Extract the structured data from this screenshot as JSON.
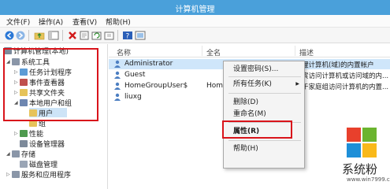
{
  "window": {
    "title": "计算机管理"
  },
  "menu": [
    "文件(F)",
    "操作(A)",
    "查看(V)",
    "帮助(H)"
  ],
  "toolbar": {
    "icons": [
      "back-arrow-icon",
      "forward-arrow-icon",
      "up-folder-icon",
      "console-tree-icon",
      "delete-icon",
      "properties-icon",
      "refresh-icon",
      "export-icon",
      "help-icon",
      "view-icon"
    ]
  },
  "tree": {
    "nodes": [
      {
        "label": "计算机管理(本地)",
        "depth": 0
      },
      {
        "label": "系统工具",
        "depth": 1
      },
      {
        "label": "任务计划程序",
        "depth": 2
      },
      {
        "label": "事件查看器",
        "depth": 2
      },
      {
        "label": "共享文件夹",
        "depth": 2
      },
      {
        "label": "本地用户和组",
        "depth": 2
      },
      {
        "label": "用户",
        "depth": 3
      },
      {
        "label": "组",
        "depth": 3
      },
      {
        "label": "性能",
        "depth": 2
      },
      {
        "label": "设备管理器",
        "depth": 2
      },
      {
        "label": "存储",
        "depth": 1
      },
      {
        "label": "磁盘管理",
        "depth": 2
      },
      {
        "label": "服务和应用程序",
        "depth": 1
      }
    ]
  },
  "list": {
    "columns": [
      "名称",
      "全名",
      "描述"
    ],
    "rows": [
      {
        "name": "Administrator",
        "fullname": "",
        "desc": "理计算机(域)的内置帐户"
      },
      {
        "name": "Guest",
        "fullname": "",
        "desc": "宾访问计算机或访问域的内..."
      },
      {
        "name": "HomeGroupUser$",
        "fullname": "HomeG",
        "desc": "于家庭组访问计算机的内置..."
      },
      {
        "name": "liuxg",
        "fullname": "",
        "desc": ""
      }
    ]
  },
  "context_menu": {
    "items": [
      "设置密码(S)...",
      "所有任务(K)",
      "删除(D)",
      "重命名(M)",
      "属性(R)",
      "帮助(H)"
    ]
  },
  "watermark": {
    "text": "系统粉",
    "url": "www.win7999.com"
  }
}
